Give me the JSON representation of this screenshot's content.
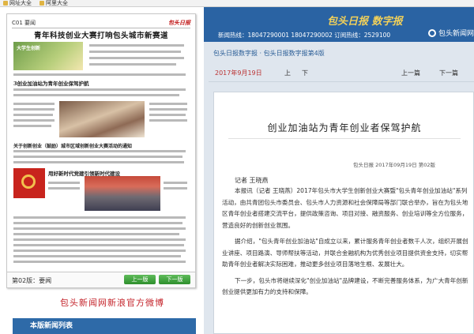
{
  "browser": {
    "favorites": [
      "网址大全",
      "阿里大全"
    ]
  },
  "paper": {
    "page_label": "C01 要闻",
    "logo": "包头日报",
    "headline": "青年科技创业大赛打响包头城市新赛道",
    "photo_caption": "大学生创新",
    "subhead2": "3创业加油站为青年创业保驾护航",
    "subhead3": "关于创新创业（鼓励）城市区域创新创业大赛活动的通知",
    "subhead4": "用好新时代党建引领新时代建设",
    "footer_label": "第02版：要闻",
    "btn_prev": "上一版",
    "btn_next": "下一版"
  },
  "left": {
    "weibo": "包头新闻网新浪官方微博",
    "news_title": "本版新闻列表"
  },
  "header": {
    "brand": "包头日报 数字报",
    "hotline": "新闻热线：18047290001  18047290002  订阅热线：2529100",
    "site": "包头新闻网"
  },
  "crumb": "包头日报数字报 · 包头日报数字报第4版",
  "datebar": {
    "date": "2017年9月19日",
    "up": "上",
    "down": "下",
    "prev": "上一篇",
    "next": "下一篇"
  },
  "article": {
    "title": "创业加油站为青年创业者保驾护航",
    "meta": "包头日报 2017年09月19日 第02版",
    "author": "记者  王晓燕",
    "paragraphs": [
      "本报讯（记者 王晓燕）2017年包头市大学生创新创业大赛暨\"包头青年创业加油站\"系列活动，由共青团包头市委员会、包头市人力资源和社会保障局等部门联合举办，旨在为包头地区青年创业者搭建交流平台，提供政策咨询、项目对接、融资服务、创业培训等全方位服务，营造良好的创新创业氛围。",
      "据介绍，\"包头青年创业加油站\"自成立以来，累计服务青年创业者数千人次，组织开展创业讲座、项目路演、导师帮扶等活动，并联合金融机构为优秀创业项目提供资金支持，切实帮助青年创业者解决实际困难，推动更多创业项目落地生根、发展壮大。",
      "下一步，包头市将继续深化\"创业加油站\"品牌建设，不断完善服务体系，为广大青年创新创业提供更加有力的支持和保障。"
    ]
  }
}
